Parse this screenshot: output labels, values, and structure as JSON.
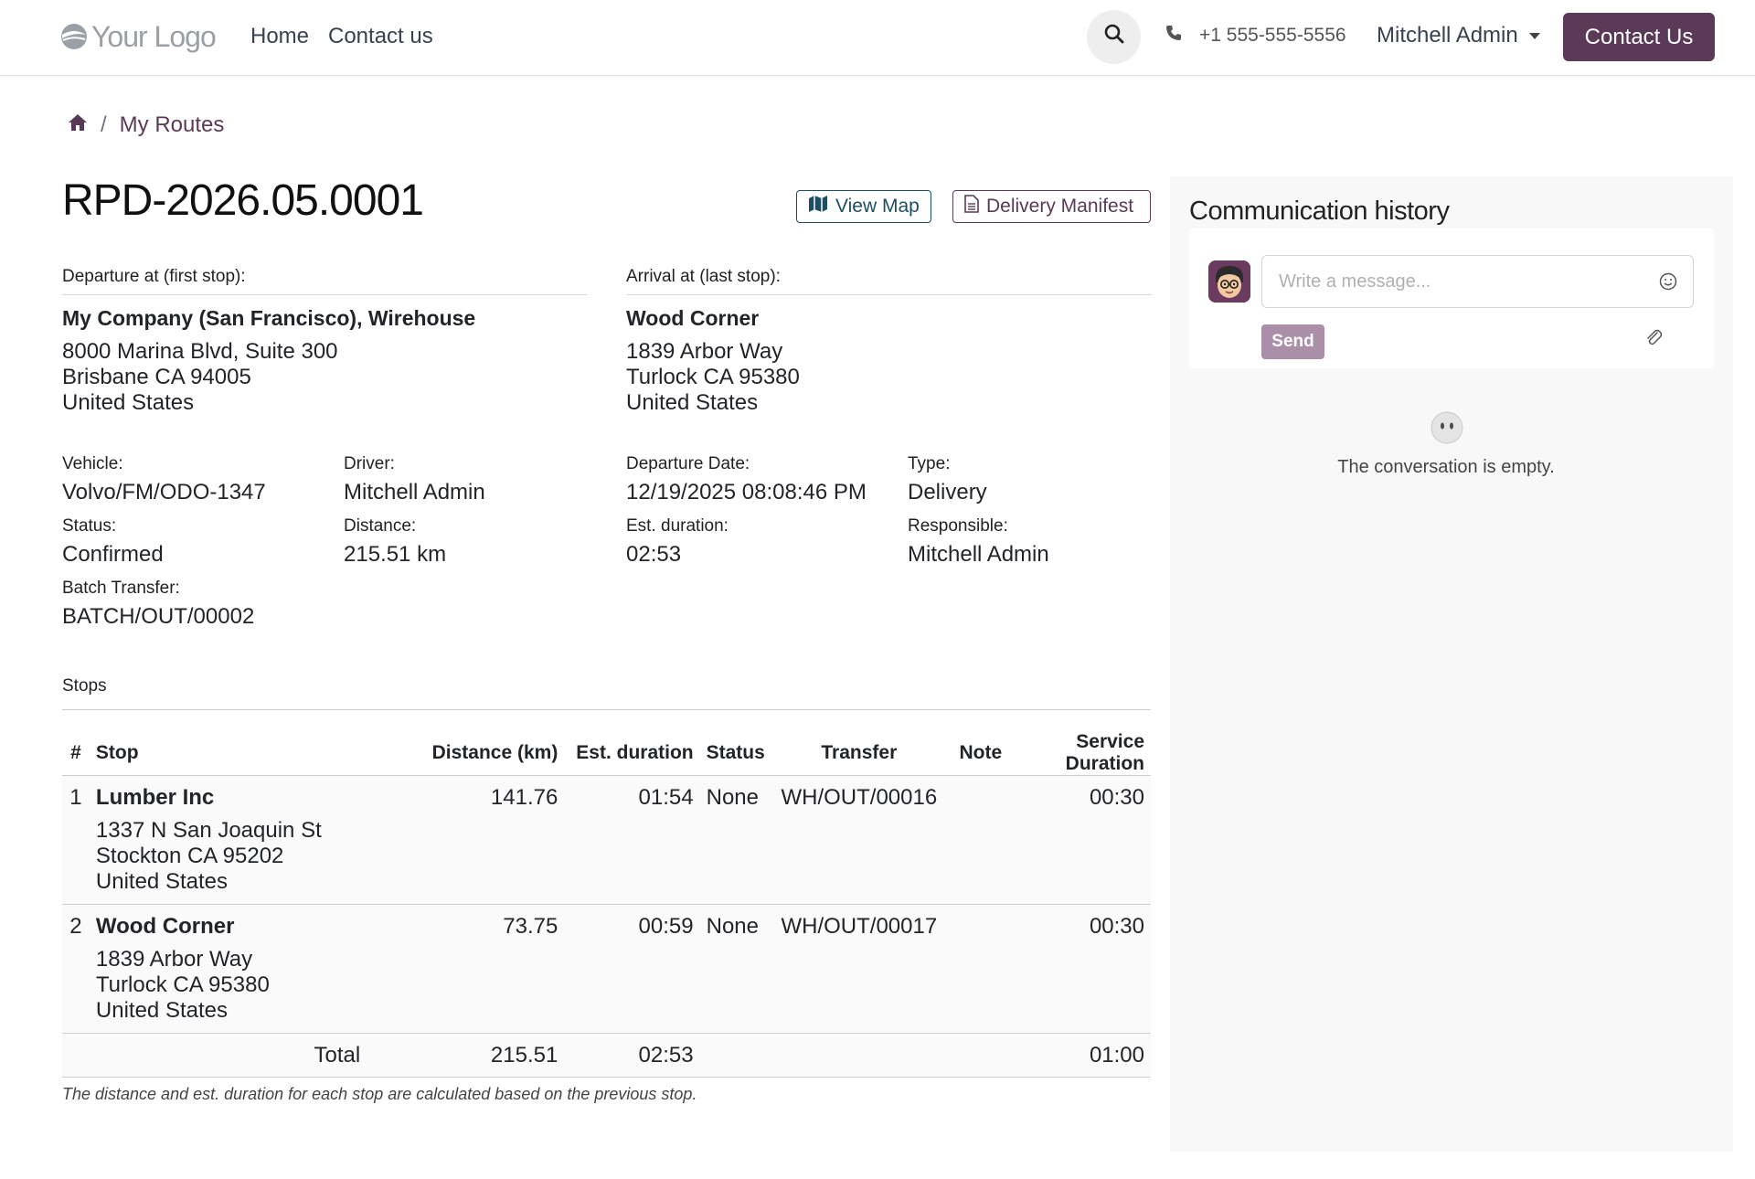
{
  "navbar": {
    "logo_text": "Your Logo",
    "links": [
      "Home",
      "Contact us"
    ],
    "phone": "+1 555-555-5556",
    "user_name": "Mitchell Admin",
    "contact_button": "Contact Us",
    "accent_color": "#5b3a58"
  },
  "breadcrumb": {
    "separator": "/",
    "current": "My Routes"
  },
  "route": {
    "title": "RPD-2026.05.0001",
    "view_map_label": "View Map",
    "manifest_label": "Delivery Manifest"
  },
  "departure": {
    "label": "Departure at (first stop):",
    "name": "My Company (San Francisco), Wirehouse",
    "lines": [
      "8000 Marina Blvd, Suite 300",
      "Brisbane CA 94005",
      "United States"
    ]
  },
  "arrival": {
    "label": "Arrival at (last stop):",
    "name": "Wood Corner",
    "lines": [
      "1839 Arbor Way",
      "Turlock CA 95380",
      "United States"
    ]
  },
  "fields": {
    "vehicle": {
      "label": "Vehicle:",
      "value": "Volvo/FM/ODO-1347"
    },
    "driver": {
      "label": "Driver:",
      "value": "Mitchell Admin"
    },
    "departure_date": {
      "label": "Departure Date:",
      "value": "12/19/2025 08:08:46 PM"
    },
    "type": {
      "label": "Type:",
      "value": "Delivery"
    },
    "status": {
      "label": "Status:",
      "value": "Confirmed"
    },
    "distance": {
      "label": "Distance:",
      "value": "215.51 km"
    },
    "est_duration": {
      "label": "Est. duration:",
      "value": "02:53"
    },
    "responsible": {
      "label": "Responsible:",
      "value": "Mitchell Admin"
    },
    "batch_transfer": {
      "label": "Batch Transfer:",
      "value": "BATCH/OUT/00002"
    }
  },
  "stops": {
    "section_label": "Stops",
    "columns": [
      "#",
      "Stop",
      "Distance (km)",
      "Est. duration",
      "Status",
      "Transfer",
      "Note",
      "Service Duration"
    ],
    "rows": [
      {
        "num": "1",
        "name": "Lumber Inc",
        "address": [
          "1337 N San Joaquin St",
          "Stockton CA 95202",
          "United States"
        ],
        "distance": "141.76",
        "duration": "01:54",
        "status": "None",
        "transfer": "WH/OUT/00016",
        "note": "",
        "service_duration": "00:30"
      },
      {
        "num": "2",
        "name": "Wood Corner",
        "address": [
          "1839 Arbor Way",
          "Turlock CA 95380",
          "United States"
        ],
        "distance": "73.75",
        "duration": "00:59",
        "status": "None",
        "transfer": "WH/OUT/00017",
        "note": "",
        "service_duration": "00:30"
      }
    ],
    "total": {
      "label": "Total",
      "distance": "215.51",
      "duration": "02:53",
      "service_duration": "01:00"
    },
    "footnote": "The distance and est. duration for each stop are calculated based on the previous stop."
  },
  "chatter": {
    "title": "Communication history",
    "message_placeholder": "Write a message...",
    "send_label": "Send",
    "empty_text": "The conversation is empty."
  }
}
